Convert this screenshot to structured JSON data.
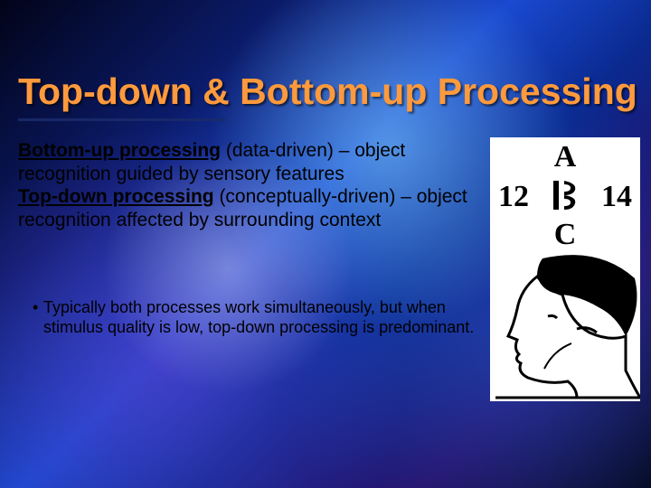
{
  "title": "Top-down & Bottom-up Processing",
  "definitions": {
    "bottom_up_label": "Bottom-up processing",
    "bottom_up_desc": " (data-driven) – object recognition guided by sensory features",
    "top_down_label": "Top-down processing",
    "top_down_desc": " (conceptually-driven) – object recognition affected by surrounding context"
  },
  "bullet": "Typically both processes work simultaneously, but when stimulus quality is low, top-down processing is predominant.",
  "figure": {
    "top_letter": "A",
    "left_num": "12",
    "center_glyph": "13/B",
    "right_num": "14",
    "bottom_letter": "C",
    "description": "Ambiguous figure: letters A-B-C vertically and numbers 12-13-14 horizontally share the center glyph; below, a line drawing that can be seen as a man's profile or a seated figure."
  }
}
